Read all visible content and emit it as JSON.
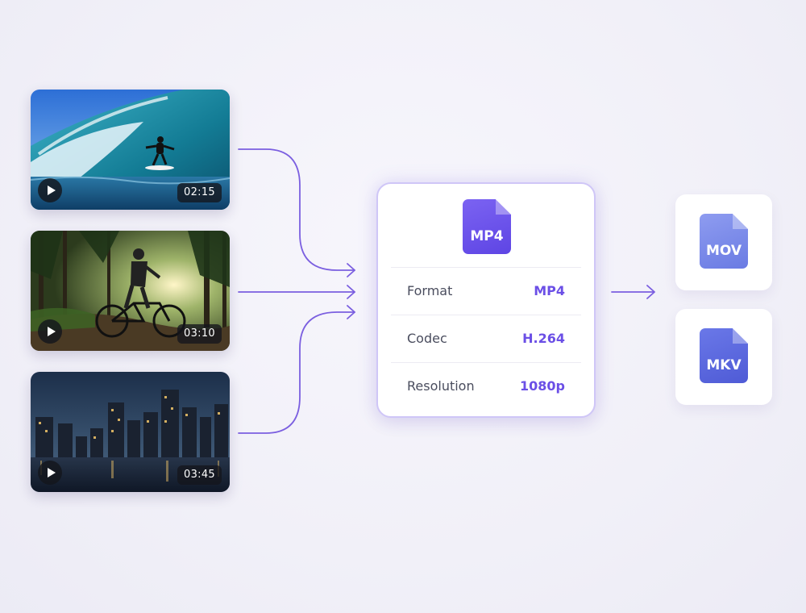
{
  "videos": [
    {
      "duration": "02:15",
      "scene": "surfer-on-wave"
    },
    {
      "duration": "03:10",
      "scene": "mountain-biker-in-forest"
    },
    {
      "duration": "03:45",
      "scene": "city-skyline-at-dusk"
    }
  ],
  "converter": {
    "format_badge": "MP4",
    "rows": [
      {
        "label": "Format",
        "value": "MP4"
      },
      {
        "label": "Codec",
        "value": "H.264"
      },
      {
        "label": "Resolution",
        "value": "1080p"
      }
    ]
  },
  "outputs": [
    {
      "ext": "MOV"
    },
    {
      "ext": "MKV"
    }
  ],
  "colors": {
    "accent": "#6b4fe6",
    "connector": "#7b5fe0",
    "card_border": "#cfc6f7",
    "label_text": "#4a4d5e"
  },
  "icons": [
    "play-icon",
    "file-icon",
    "arrow-right-icon"
  ]
}
